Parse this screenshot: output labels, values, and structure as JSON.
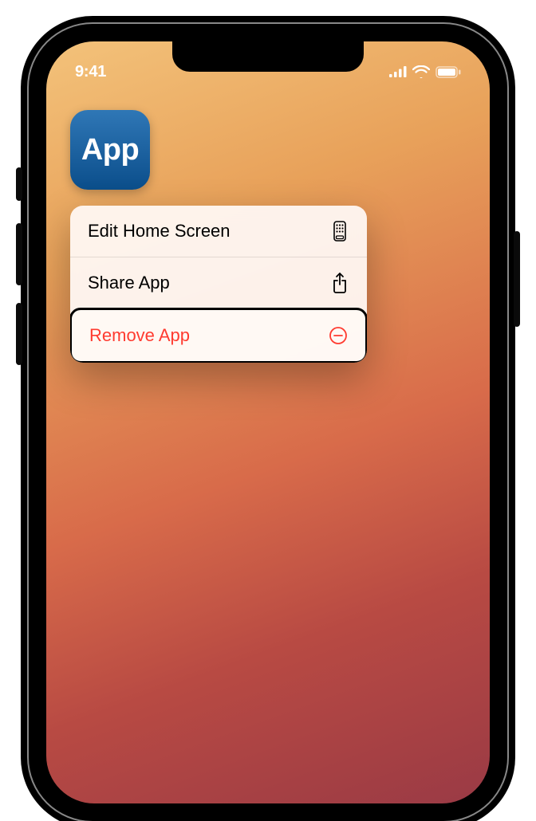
{
  "status_bar": {
    "time": "9:41"
  },
  "app": {
    "label": "App"
  },
  "context_menu": {
    "items": [
      {
        "label": "Edit Home Screen",
        "icon": "home-screen-icon",
        "destructive": false
      },
      {
        "label": "Share App",
        "icon": "share-icon",
        "destructive": false
      },
      {
        "label": "Remove App",
        "icon": "remove-icon",
        "destructive": true,
        "highlighted": true
      }
    ]
  },
  "colors": {
    "destructive": "#ff3b30",
    "app_icon_top": "#2f77b6",
    "app_icon_bottom": "#0b4e8b"
  }
}
